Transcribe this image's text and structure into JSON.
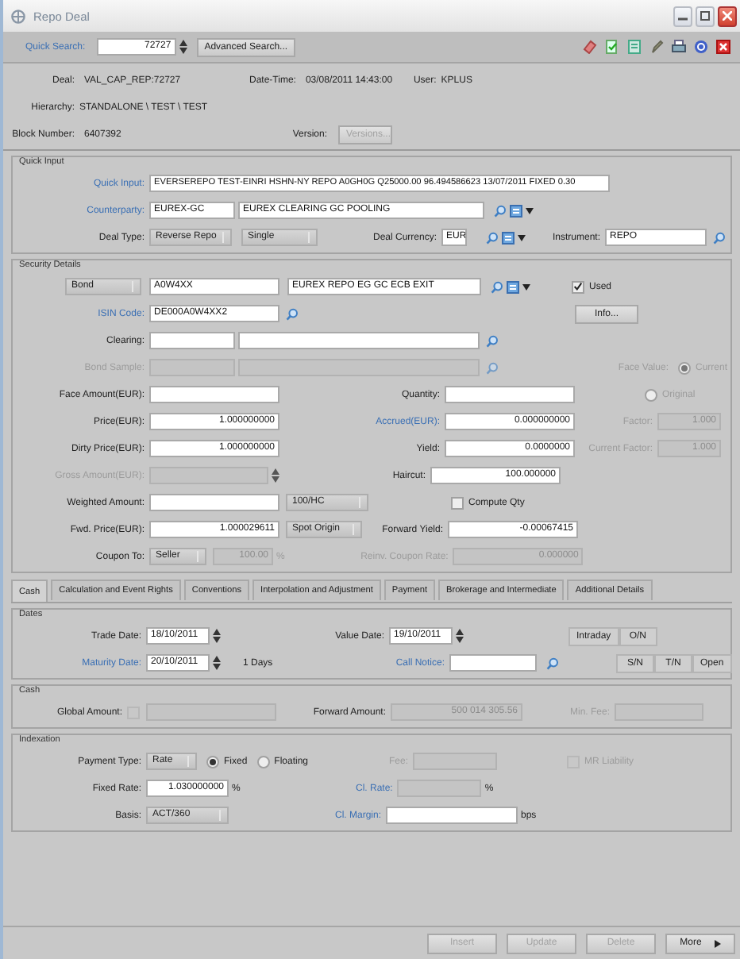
{
  "window": {
    "title": "Repo Deal"
  },
  "toolbar": {
    "quick_search_label": "Quick Search:",
    "quick_search_value": "72727",
    "advanced_search": "Advanced Search..."
  },
  "header": {
    "deal_label": "Deal:",
    "deal": "VAL_CAP_REP:72727",
    "datetime_label": "Date-Time:",
    "datetime": "03/08/2011 14:43:00",
    "user_label": "User:",
    "user": "KPLUS",
    "hierarchy_label": "Hierarchy:",
    "hierarchy": "STANDALONE \\ TEST \\ TEST",
    "block_label": "Block Number:",
    "block": "6407392",
    "version_label": "Version:",
    "versions_button": {
      "label": "Versions...",
      "disabled": true
    }
  },
  "quick_input": {
    "title": "Quick Input",
    "input": {
      "label": "Quick Input:",
      "value": "EVERSEREPO TEST-EINRI HSHN-NY REPO A0GH0G Q25000.00 96.494586623 13/07/2011 FIXED 0.30",
      "link": true
    },
    "counterparty": {
      "label": "Counterparty:",
      "value": "EUREX-GC",
      "name": "EUREX CLEARING GC POOLING",
      "link": true
    },
    "deal_type": {
      "label": "Deal Type:",
      "value": "Reverse Repo",
      "subtype": "Single"
    },
    "deal_currency": {
      "label": "Deal Currency:",
      "value": "EUR"
    },
    "instrument": {
      "label": "Instrument:",
      "value": "REPO"
    }
  },
  "security": {
    "title": "Security Details",
    "bond": {
      "button": "Bond",
      "code": "A0W4XX",
      "name": "EUREX REPO EG GC ECB EXIT"
    },
    "used": {
      "label": "Used",
      "checked": true
    },
    "isin": {
      "label": "ISIN Code:",
      "value": "DE000A0W4XX2",
      "link": true
    },
    "info_button": "Info...",
    "clearing": {
      "label": "Clearing:"
    },
    "bond_sample": {
      "label": "Bond Sample:",
      "disabled": true
    },
    "face_value": {
      "label": "Face Value:",
      "disabled": true,
      "options": [
        {
          "label": "Current",
          "selected": true
        },
        {
          "label": "Original",
          "selected": false
        }
      ]
    },
    "face_amount": {
      "label": "Face Amount(EUR):"
    },
    "quantity": {
      "label": "Quantity:"
    },
    "price": {
      "label": "Price(EUR):",
      "value": "1.000000000"
    },
    "accrued": {
      "label": "Accrued(EUR):",
      "value": "0.000000000",
      "link": true
    },
    "factor": {
      "label": "Factor:",
      "value": "1.000",
      "disabled": true
    },
    "dirty_price": {
      "label": "Dirty Price(EUR):",
      "value": "1.000000000"
    },
    "yield": {
      "label": "Yield:",
      "value": "0.0000000"
    },
    "current_factor": {
      "label": "Current Factor:",
      "value": "1.000",
      "disabled": true
    },
    "gross_amount": {
      "label": "Gross Amount(EUR):",
      "disabled": true
    },
    "haircut": {
      "label": "Haircut:",
      "value": "100.000000"
    },
    "weighted_amount": {
      "label": "Weighted Amount:"
    },
    "weighting": "100/HC",
    "compute_qty": {
      "label": "Compute Qty",
      "checked": false
    },
    "fwd_price": {
      "label": "Fwd. Price(EUR):",
      "value": "1.000029611"
    },
    "fwd_basis": "Spot Origin",
    "forward_yield": {
      "label": "Forward Yield:",
      "value": "-0.00067415"
    },
    "coupon_to": {
      "label": "Coupon To:",
      "value": "Seller"
    },
    "coupon_share": {
      "value": "100.00",
      "unit": "%",
      "disabled": true
    },
    "reinv_rate": {
      "label": "Reinv. Coupon Rate:",
      "value": "0.000000",
      "disabled": true
    }
  },
  "tabs": [
    {
      "label": "Cash",
      "selected": true
    },
    {
      "label": "Calculation and Event Rights",
      "selected": false
    },
    {
      "label": "Conventions",
      "selected": false
    },
    {
      "label": "Interpolation and Adjustment",
      "selected": false
    },
    {
      "label": "Payment",
      "selected": false
    },
    {
      "label": "Brokerage and Intermediate",
      "selected": false
    },
    {
      "label": "Additional Details",
      "selected": false
    }
  ],
  "dates": {
    "title": "Dates",
    "trade_date": {
      "label": "Trade Date:",
      "value": "18/10/2011"
    },
    "value_date": {
      "label": "Value Date:",
      "value": "19/10/2011"
    },
    "maturity_date": {
      "label": "Maturity Date:",
      "value": "20/10/2011",
      "link": true
    },
    "duration": "1 Days",
    "call_notice": {
      "label": "Call Notice:",
      "link": true
    },
    "quick_buttons": [
      [
        "Intraday",
        "O/N"
      ],
      [
        "S/N",
        "T/N",
        "Open"
      ]
    ]
  },
  "cash": {
    "title": "Cash",
    "global_amount": {
      "label": "Global Amount:",
      "checked": false,
      "disabled": true
    },
    "forward_amount": {
      "label": "Forward Amount:",
      "value": "500 014 305.56",
      "disabled": true
    },
    "min_fee": {
      "label": "Min. Fee:",
      "disabled": true
    }
  },
  "indexation": {
    "title": "Indexation",
    "payment_type": {
      "label": "Payment Type:",
      "value": "Rate"
    },
    "rate_options": [
      {
        "label": "Fixed",
        "selected": true
      },
      {
        "label": "Floating",
        "selected": false
      }
    ],
    "fee": {
      "label": "Fee:",
      "disabled": true
    },
    "mr_liability": {
      "label": "MR Liability",
      "checked": false,
      "disabled": true
    },
    "fixed_rate": {
      "label": "Fixed Rate:",
      "value": "1.030000000",
      "unit": "%"
    },
    "cl_rate": {
      "label": "Cl. Rate:",
      "unit": "%",
      "link": true,
      "disabled": true
    },
    "basis": {
      "label": "Basis:",
      "value": "ACT/360"
    },
    "cl_margin": {
      "label": "Cl. Margin:",
      "unit": "bps",
      "link": true
    }
  },
  "actions": [
    {
      "label": "Insert",
      "disabled": true
    },
    {
      "label": "Update",
      "disabled": true
    },
    {
      "label": "Delete",
      "disabled": true
    },
    {
      "label": "More",
      "disabled": false
    }
  ]
}
